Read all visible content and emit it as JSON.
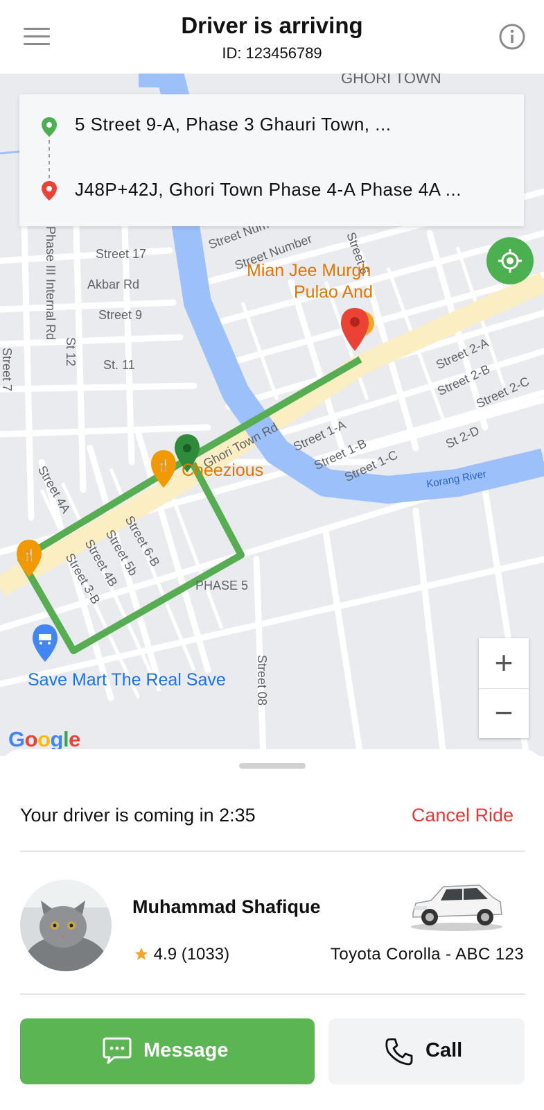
{
  "header": {
    "title": "Driver is arriving",
    "ride_id": "ID: 123456789"
  },
  "route": {
    "pickup": "5 Street 9-A, Phase 3 Ghauri Town, ...",
    "dropoff": "J48P+42J, Ghori Town Phase 4-A Phase 4A ..."
  },
  "map": {
    "labels": {
      "ghori_town": "GHORI TOWN",
      "street7": "Street 7",
      "phase3_internal": "Phase III Internal Rd",
      "street17": "Street 17",
      "akbar_rd": "Akbar Rd",
      "st12": "St 12",
      "street9": "Street 9",
      "st11": "St. 11",
      "street_num1": "Street Num",
      "street_num2": "Street Number",
      "street6": "Street 6",
      "street2a": "Street 2-A",
      "street2b": "Street 2-B",
      "street2c": "Street 2-C",
      "street1a": "Street 1-A",
      "street1b": "Street 1-B",
      "street1c": "Street 1-C",
      "st2d": "St 2-D",
      "ghori_town_rd": "Ghori Town Rd",
      "korang_river": "Korang River",
      "street4a": "Street 4A",
      "street6b": "Street 6-B",
      "street5b": "Street 5b",
      "street4b": "Street 4B",
      "street3b": "Street 3-B",
      "phase5": "PHASE 5",
      "street08": "Street 08"
    },
    "pois": {
      "mian_jee_1": "Mian Jee Murgh",
      "mian_jee_2": "Pulao And",
      "cheezious": "Cheezious",
      "save_mart": "Save Mart The Real Save"
    },
    "zoom_in": "+",
    "zoom_out": "−",
    "google_logo": "Google"
  },
  "trip": {
    "eta_text": "Your driver is coming in 2:35",
    "cancel_label": "Cancel Ride"
  },
  "driver": {
    "name": "Muhammad Shafique",
    "rating": "4.9 (1033)",
    "car": "Toyota Corolla - ABC 123"
  },
  "actions": {
    "message_label": "Message",
    "call_label": "Call"
  },
  "colors": {
    "accent_green": "#5ab552",
    "route_green": "#56ad52",
    "cancel_red": "#e53935",
    "river_blue": "#9cc0f9",
    "poi_orange": "#e07800"
  },
  "icons": [
    "menu-icon",
    "info-icon",
    "pickup-pin-icon",
    "dropoff-pin-icon",
    "my-location-icon",
    "restaurant-pin-icon",
    "shopping-cart-pin-icon",
    "driver-pin-icon",
    "star-icon",
    "chat-bubble-icon",
    "phone-icon"
  ]
}
